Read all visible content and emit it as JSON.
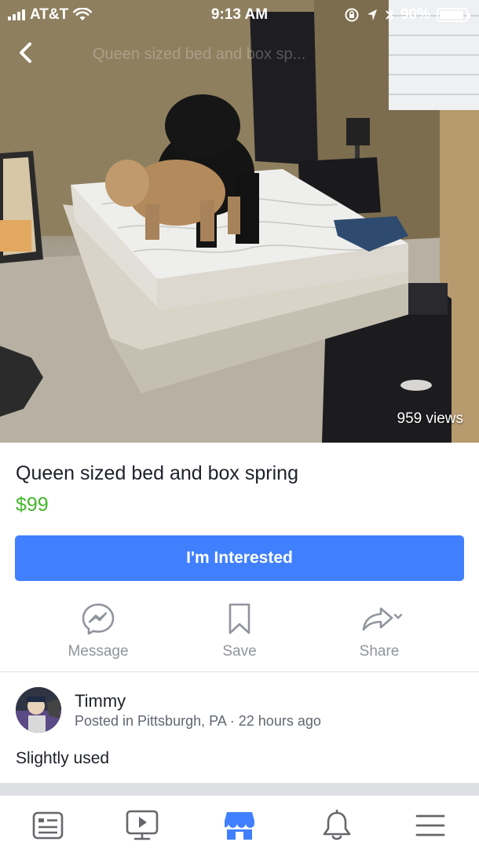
{
  "status_bar": {
    "carrier": "AT&T",
    "time": "9:13 AM",
    "battery": "90%"
  },
  "header": {
    "back_label": "Back",
    "faded_title": "Queen sized bed and box sp..."
  },
  "photo": {
    "views": "959 views"
  },
  "listing": {
    "title": "Queen sized bed and box spring",
    "price": "$99",
    "interested_label": "I'm Interested"
  },
  "actions": {
    "message": "Message",
    "save": "Save",
    "share": "Share"
  },
  "seller": {
    "name": "Timmy",
    "meta": "Posted in Pittsburgh, PA · 22 hours ago"
  },
  "description": "Slightly used",
  "tab_bar": {
    "icons": [
      "news-feed-icon",
      "watch-icon",
      "marketplace-icon",
      "notifications-icon",
      "menu-icon"
    ],
    "active": "marketplace-icon"
  },
  "colors": {
    "accent": "#4080ff",
    "price": "#42b72a",
    "muted": "#90949c",
    "icon": "#65676b"
  }
}
